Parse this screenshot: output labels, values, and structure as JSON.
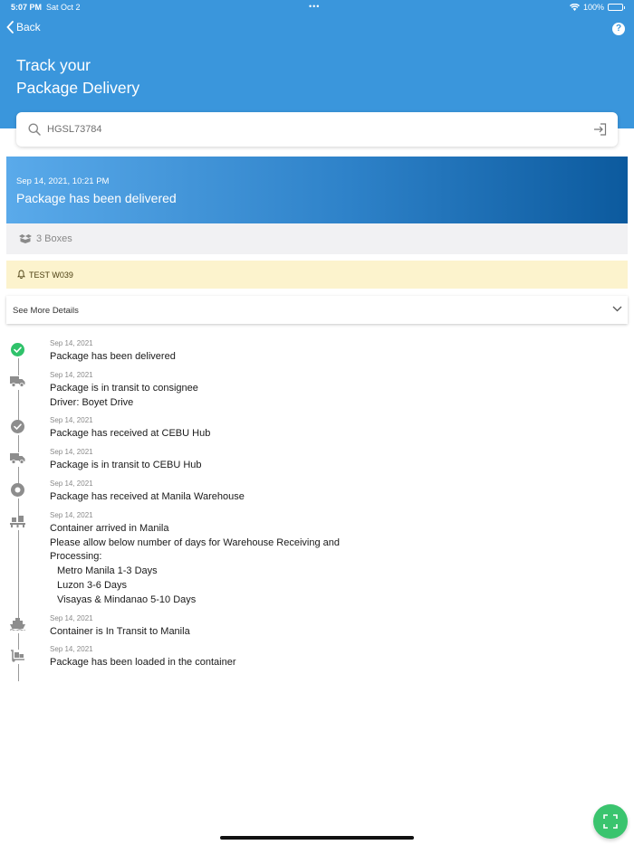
{
  "status_bar": {
    "time": "5:07 PM",
    "date": "Sat Oct 2",
    "battery": "100%"
  },
  "header": {
    "back_label": "Back",
    "help_label": "?",
    "title_line1": "Track your",
    "title_line2": "Package Delivery"
  },
  "search": {
    "value": "HGSL73784"
  },
  "banner": {
    "date": "Sep 14, 2021, 10:21 PM",
    "status": "Package has been delivered"
  },
  "boxes": {
    "label": "3 Boxes"
  },
  "notice": {
    "label": "TEST W039"
  },
  "details": {
    "label": "See More Details"
  },
  "timeline": [
    {
      "date": "Sep 14, 2021",
      "icon": "check-circle-green-icon",
      "lines": [
        "Package has been delivered"
      ]
    },
    {
      "date": "Sep 14, 2021",
      "icon": "truck-icon",
      "lines": [
        "Package is in transit to consignee",
        "Driver: Boyet Drive"
      ]
    },
    {
      "date": "Sep 14, 2021",
      "icon": "check-circle-icon",
      "lines": [
        "Package has received at CEBU Hub"
      ]
    },
    {
      "date": "Sep 14, 2021",
      "icon": "truck-icon",
      "lines": [
        "Package is in transit to CEBU Hub"
      ]
    },
    {
      "date": "Sep 14, 2021",
      "icon": "dot-circle-icon",
      "lines": [
        "Package has received at Manila Warehouse"
      ]
    },
    {
      "date": "Sep 14, 2021",
      "icon": "pallet-icon",
      "lines": [
        "Container arrived in Manila",
        "Please allow below number of days for Warehouse Receiving and",
        "Processing:"
      ],
      "indented": [
        "Metro Manila 1-3 Days",
        "Luzon 3-6 Days",
        "Visayas & Mindanao 5-10 Days"
      ]
    },
    {
      "date": "Sep 14, 2021",
      "icon": "ship-icon",
      "lines": [
        "Container is In Transit to Manila"
      ]
    },
    {
      "date": "Sep 14, 2021",
      "icon": "dolly-icon",
      "lines": [
        "Package has been loaded in the container"
      ]
    }
  ],
  "colors": {
    "header": "#3a96dc",
    "fab": "#3ac46e",
    "notice": "#fcf3cd",
    "check": "#2fc26a"
  }
}
